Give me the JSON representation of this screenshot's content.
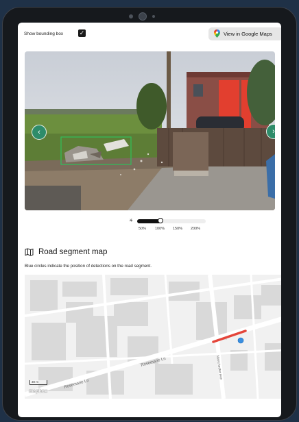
{
  "topbar": {
    "bounding_box_label": "Show bounding box",
    "bounding_box_checked": true,
    "google_maps_label": "View in Google Maps"
  },
  "zoom": {
    "ticks": [
      "50%",
      "100%",
      "150%",
      "200%"
    ],
    "selected": "100%"
  },
  "map_section": {
    "title": "Road segment map",
    "description": "Blue circles indicate the position of detections on the road segment.",
    "street_labels": [
      "Rosemarie Ln",
      "Rosemarie Ln",
      "Manchester Ave"
    ],
    "scale_label": "30 m",
    "attribution": "mapbox"
  },
  "colors": {
    "accent_green": "#2e8c6a",
    "segment_red": "#e4453a",
    "detection_blue": "#3a8fe0"
  }
}
